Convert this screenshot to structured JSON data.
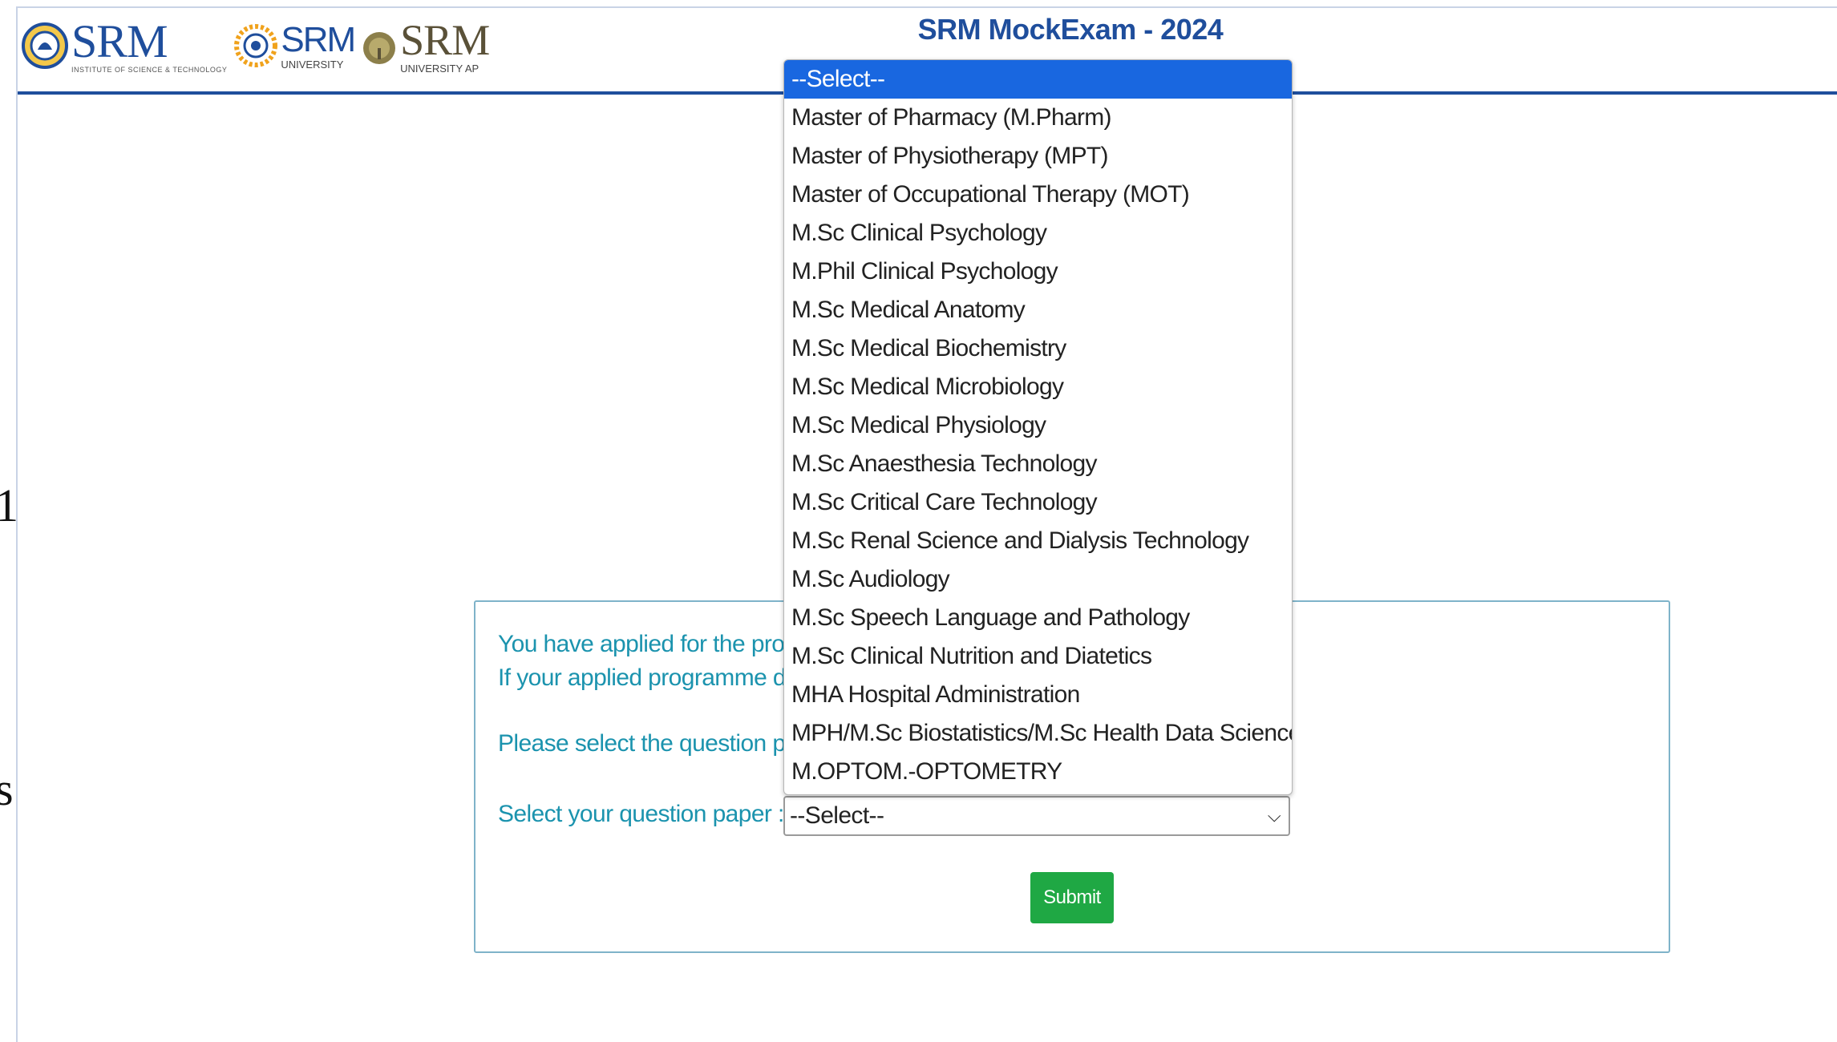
{
  "header": {
    "title": "SRM MockExam - 2024",
    "logos": [
      {
        "name": "SRM",
        "sub": "INSTITUTE OF SCIENCE & TECHNOLOGY"
      },
      {
        "name": "SRM",
        "sub": "UNIVERSITY"
      },
      {
        "name": "SRM",
        "sub": "UNIVERSITY AP"
      }
    ]
  },
  "edge_glyphs": [
    "1",
    "s"
  ],
  "panel": {
    "line1": "You have applied for the pro",
    "line2": "If your applied programme d",
    "line3": "Please select the question pa",
    "select_label": "Select your question paper :",
    "select_value": "--Select--",
    "submit_label": "Submit"
  },
  "dropdown": {
    "selected_index": 0,
    "options": [
      "--Select--",
      "Master of Pharmacy (M.Pharm)",
      "Master of Physiotherapy (MPT)",
      "Master of Occupational Therapy (MOT)",
      "M.Sc Clinical Psychology",
      "M.Phil Clinical Psychology",
      "M.Sc Medical Anatomy",
      "M.Sc Medical Biochemistry",
      "M.Sc Medical Microbiology",
      "M.Sc Medical Physiology",
      "M.Sc Anaesthesia Technology",
      "M.Sc Critical Care Technology",
      "M.Sc Renal Science and Dialysis Technology",
      "M.Sc Audiology",
      "M.Sc Speech Language and Pathology",
      "M.Sc Clinical Nutrition and Diatetics",
      "MHA Hospital Administration",
      "MPH/M.Sc Biostatistics/M.Sc Health Data Science",
      "M.OPTOM.-OPTOMETRY"
    ]
  },
  "colors": {
    "brand_blue": "#1f4e9c",
    "teal_text": "#1b93ae",
    "submit_green": "#1fa844",
    "highlight_blue": "#1967e0"
  }
}
